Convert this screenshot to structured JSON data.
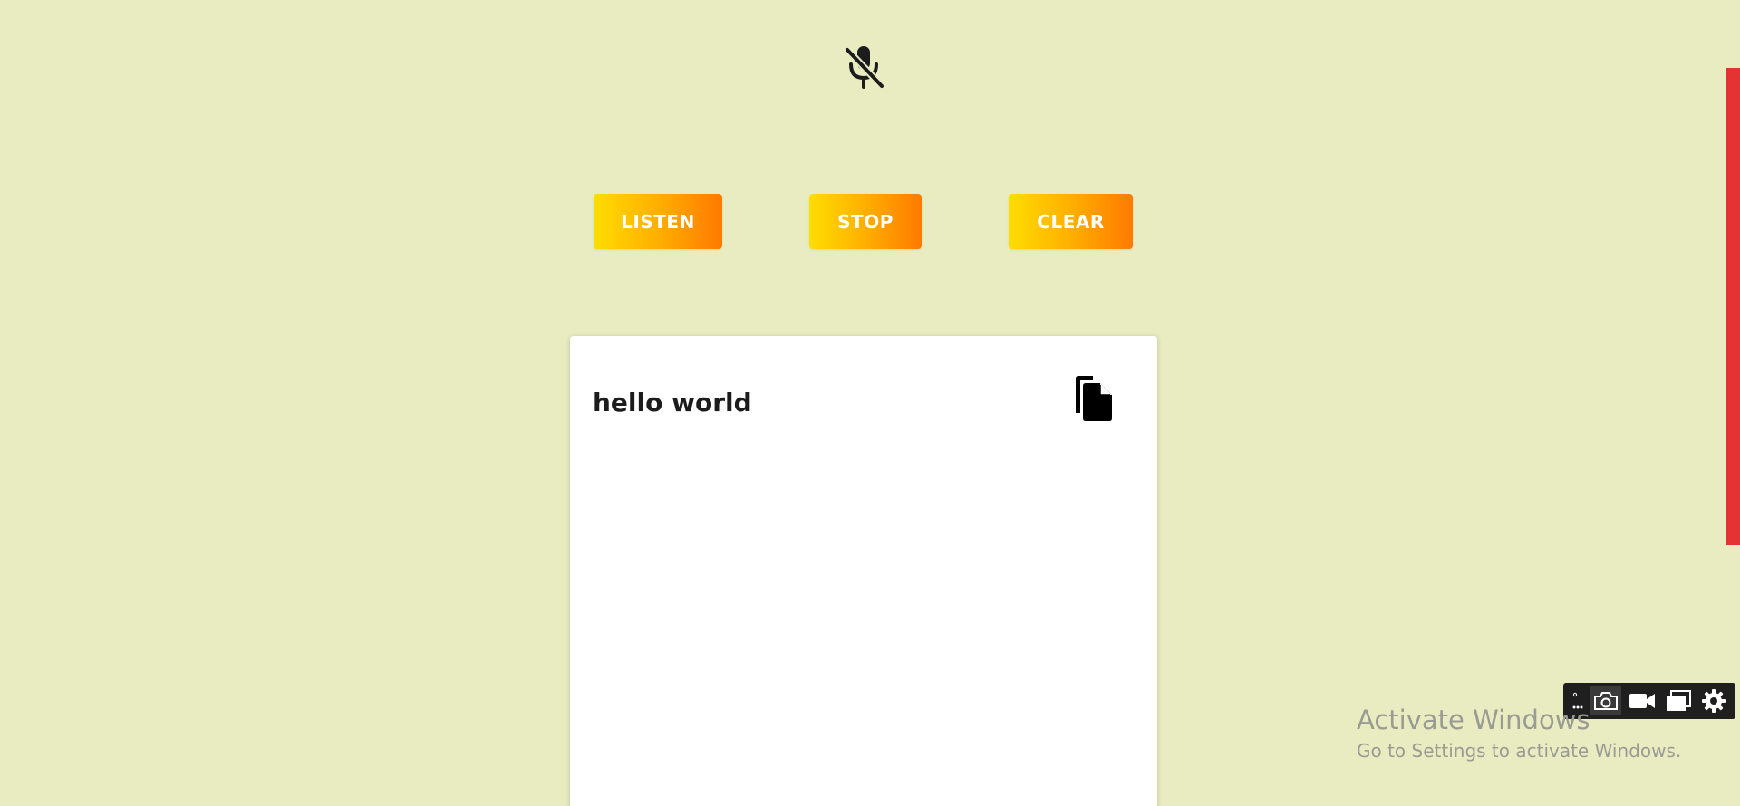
{
  "mic": {
    "status_icon": "mic-off-icon",
    "color": "#1c1c1c"
  },
  "controls": {
    "listen_label": "LISTEN",
    "stop_label": "STOP",
    "clear_label": "CLEAR",
    "gradient_start": "#ffdd00",
    "gradient_end": "#ff7a00"
  },
  "transcript": {
    "text": "hello world",
    "copy_icon": "copy-icon"
  },
  "scroll_indicator_color": "#e53232",
  "capture_toolbar": {
    "icons": [
      "more-icon",
      "camera-icon",
      "video-icon",
      "window-icon",
      "gear-icon"
    ]
  },
  "watermark": {
    "title": "Activate Windows",
    "subtitle": "Go to Settings to activate Windows."
  },
  "colors": {
    "background": "#e8ecc0",
    "card": "#ffffff"
  }
}
